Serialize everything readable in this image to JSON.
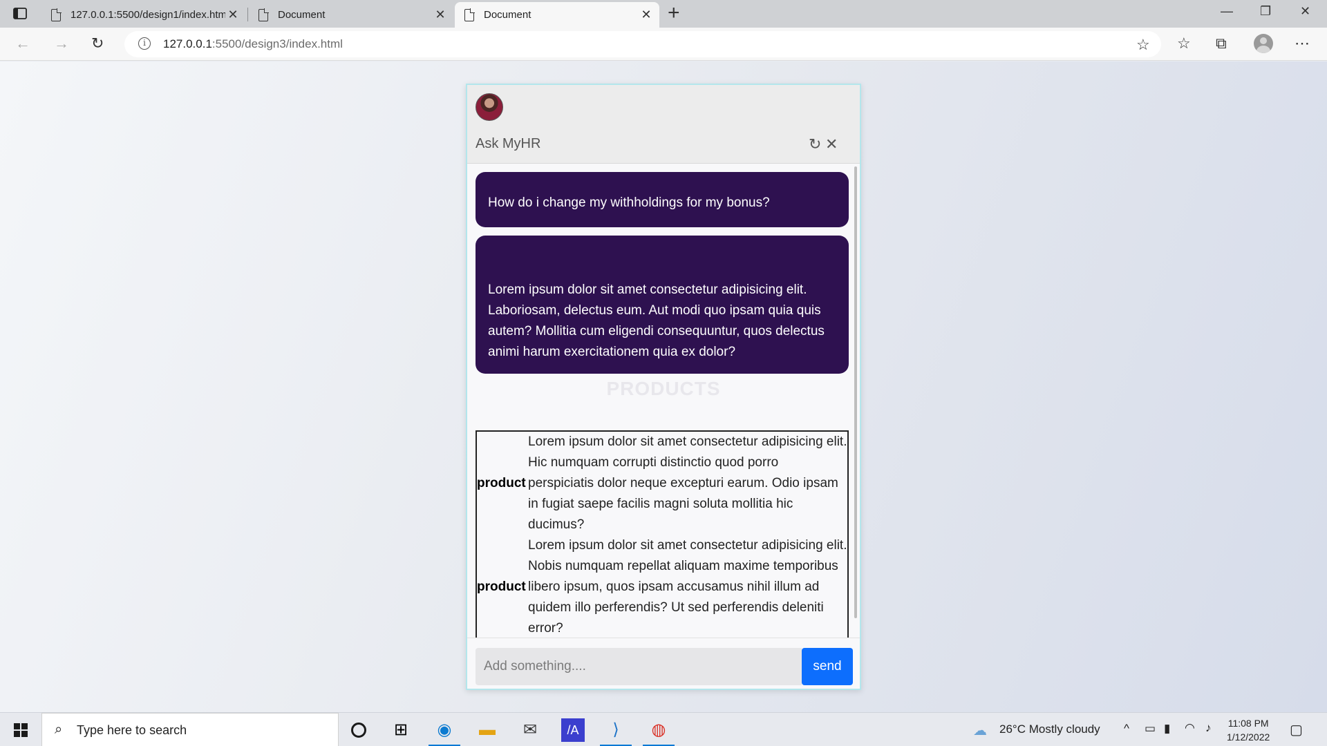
{
  "browser": {
    "tabs": [
      {
        "title": "127.0.0.1:5500/design1/index.htm",
        "active": false
      },
      {
        "title": "Document",
        "active": false
      },
      {
        "title": "Document",
        "active": true
      }
    ],
    "close_glyph": "✕",
    "new_tab_glyph": "+",
    "url_host": "127.0.0.1",
    "url_rest": ":5500/design3/index.html",
    "window_controls": {
      "minimize": "—",
      "restore": "❐",
      "close": "✕"
    }
  },
  "chat": {
    "title": "Ask MyHR",
    "refresh_icon": "↻",
    "close_icon": "✕",
    "messages": [
      {
        "role": "user",
        "text": "How do i change my withholdings for my bonus?"
      },
      {
        "role": "bot",
        "text": "Lorem ipsum dolor sit amet consectetur adipisicing elit. Laboriosam, delectus eum. Aut modi quo ipsam quia quis autem? Mollitia cum eligendi consequuntur, quos delectus animi harum exercitationem quia ex dolor?"
      }
    ],
    "products_heading": "PRODUCTS",
    "products": [
      {
        "label": "product",
        "description": "Lorem ipsum dolor sit amet consectetur adipisicing elit. Hic numquam corrupti distinctio quod porro perspiciatis dolor neque excepturi earum. Odio ipsam in fugiat saepe facilis magni soluta mollitia hic ducimus?"
      },
      {
        "label": "product",
        "description": "Lorem ipsum dolor sit amet consectetur adipisicing elit. Nobis numquam repellat aliquam maxime temporibus libero ipsum, quos ipsam accusamus nihil illum ad quidem illo perferendis? Ut sed perferendis deleniti error?"
      }
    ],
    "input_placeholder": "Add something....",
    "input_value": "",
    "send_label": "send",
    "colors": {
      "bubble": "#2e1150",
      "send": "#0d6efd",
      "border": "#b3e6ec"
    }
  },
  "taskbar": {
    "search_placeholder": "Type here to search",
    "weather": "26°C  Mostly cloudy",
    "time": "11:08 PM",
    "date": "1/12/2022",
    "apps": [
      "task-view-icon",
      "edge-icon",
      "file-explorer-icon",
      "mail-icon",
      "app-icon",
      "vscode-icon",
      "chrome-icon"
    ]
  }
}
